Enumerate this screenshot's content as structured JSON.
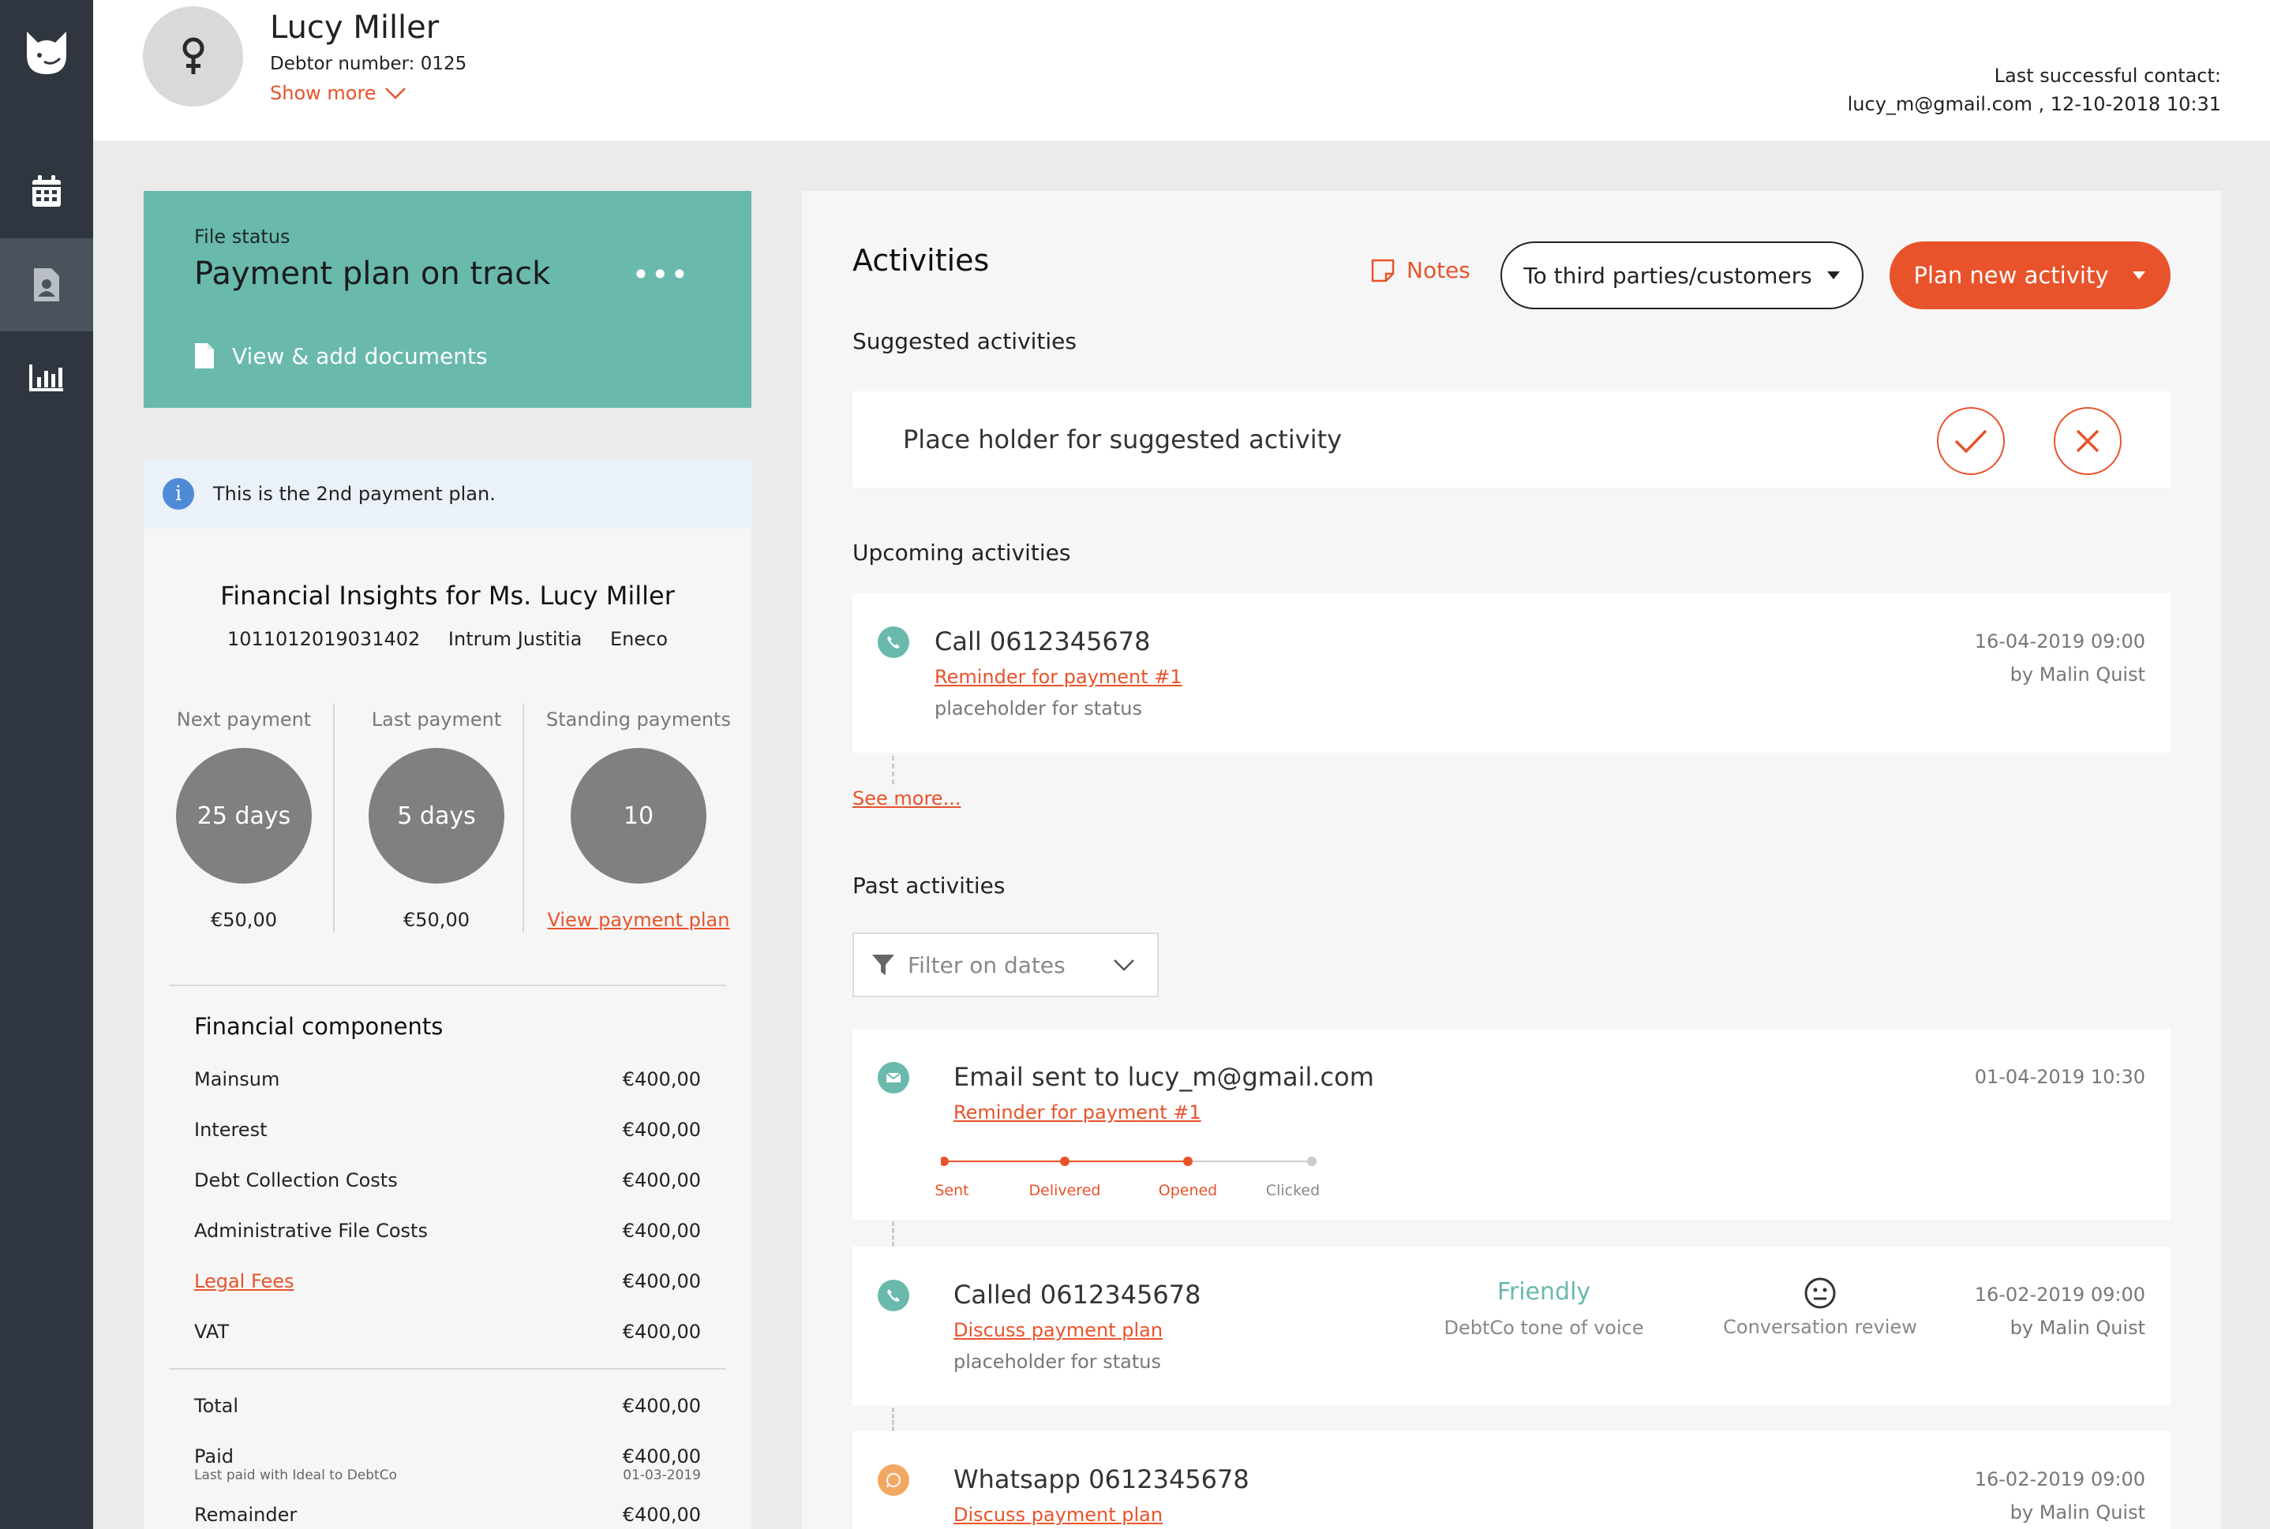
{
  "sidebar": {
    "items": [
      {
        "name": "calendar",
        "active": false
      },
      {
        "name": "debtor-file",
        "active": true
      },
      {
        "name": "reports",
        "active": false
      }
    ]
  },
  "header": {
    "debtor_name": "Lucy Miller",
    "debtor_number": "Debtor number: 0125",
    "show_more": "Show more",
    "last_contact_label": "Last successful contact:",
    "last_contact_value": "lucy_m@gmail.com ,  12-10-2018 10:31"
  },
  "file_status": {
    "label": "File status",
    "title": "Payment plan on track",
    "menu": "•••",
    "documents_label": "View & add documents",
    "color": "#69b9ad"
  },
  "info_banner": {
    "icon": "i",
    "text": "This is the 2nd payment plan."
  },
  "financial_insights": {
    "title": "Financial Insights for Ms. Lucy Miller",
    "reference": "1011012019031402",
    "creditor": "Intrum Justitia",
    "client": "Eneco",
    "payments": [
      {
        "label": "Next payment",
        "value": "25 days",
        "amount": "€50,00"
      },
      {
        "label": "Last payment",
        "value": "5 days",
        "amount": "€50,00"
      },
      {
        "label": "Standing payments",
        "value": "10",
        "link": "View payment plan"
      }
    ]
  },
  "financial_components": {
    "title": "Financial components",
    "rows": [
      {
        "label": "Mainsum",
        "amount": "€400,00"
      },
      {
        "label": "Interest",
        "amount": "€400,00"
      },
      {
        "label": "Debt Collection Costs",
        "amount": "€400,00"
      },
      {
        "label": "Administrative File Costs",
        "amount": "€400,00"
      },
      {
        "label": "Legal Fees",
        "amount": "€400,00"
      },
      {
        "label": "VAT",
        "amount": "€400,00"
      }
    ],
    "totals": [
      {
        "label": "Total",
        "amount": "€400,00"
      },
      {
        "label": "Paid",
        "amount": "€400,00",
        "sub_label": "Last paid with Ideal to DebtCo",
        "sub_amount": "01-03-2019"
      },
      {
        "label": "Remainder",
        "amount": "€400,00"
      }
    ]
  },
  "activities": {
    "title": "Activities",
    "notes_label": "Notes",
    "filter_dropdown": "To third parties/customers",
    "plan_button": "Plan new activity",
    "accent_color": "#e8532b",
    "suggested_title": "Suggested activities",
    "suggested_text": "Place holder for suggested activity",
    "upcoming_title": "Upcoming activities",
    "upcoming": [
      {
        "title": "Call 0612345678",
        "link": "Reminder for payment #1",
        "status": "placeholder for status",
        "date": "16-04-2019 09:00",
        "by": "by Malin Quist",
        "icon": "phone-icon"
      }
    ],
    "see_more": "See more...",
    "past_title": "Past activities",
    "date_filter_placeholder": "Filter on dates",
    "past": [
      {
        "title": "Email sent to lucy_m@gmail.com",
        "link": "Reminder for payment #1",
        "date": "01-04-2019 10:30",
        "icon": "email-icon",
        "tracking": [
          "Sent",
          "Delivered",
          "Opened",
          "Clicked"
        ]
      },
      {
        "title": "Called 0612345678",
        "link": "Discuss payment plan",
        "status": "placeholder for status",
        "tone_value": "Friendly",
        "tone_label": "DebtCo tone of voice",
        "review_label": "Conversation review",
        "date": "16-02-2019 09:00",
        "by": "by Malin Quist",
        "icon": "phone-icon"
      },
      {
        "title": "Whatsapp 0612345678",
        "link": "Discuss payment plan",
        "date": "16-02-2019 09:00",
        "by": "by Malin Quist",
        "icon": "whatsapp-icon"
      }
    ]
  }
}
